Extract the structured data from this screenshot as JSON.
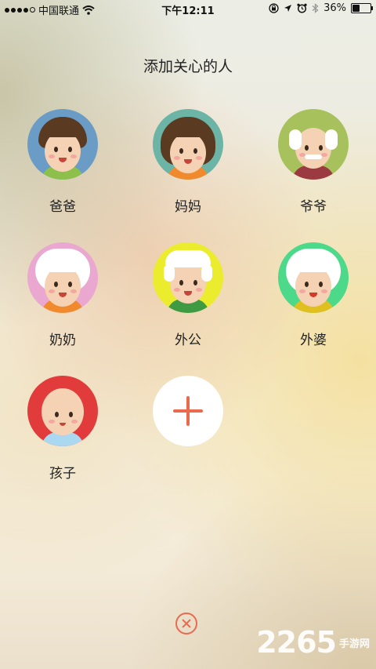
{
  "status_bar": {
    "carrier": "中国联通",
    "time": "下午12:11",
    "battery": "36%",
    "battery_level": 0.36
  },
  "page": {
    "title": "添加关心的人"
  },
  "members": [
    {
      "id": "dad",
      "label": "爸爸",
      "ring_color": "#6a9cc6"
    },
    {
      "id": "mom",
      "label": "妈妈",
      "ring_color": "#6bb4a6"
    },
    {
      "id": "grandpa-paternal",
      "label": "爷爷",
      "ring_color": "#a7c15c"
    },
    {
      "id": "grandma-paternal",
      "label": "奶奶",
      "ring_color": "#eaa7cf"
    },
    {
      "id": "grandpa-maternal",
      "label": "外公",
      "ring_color": "#ecec2e"
    },
    {
      "id": "grandma-maternal",
      "label": "外婆",
      "ring_color": "#4cd98a"
    },
    {
      "id": "child",
      "label": "孩子",
      "ring_color": "#e23b3b"
    }
  ],
  "actions": {
    "add_icon": "plus-icon",
    "close_icon": "close-circle-icon",
    "accent_color": "#ea6a4e"
  },
  "watermark": {
    "number": "2265",
    "text": "手游网"
  }
}
